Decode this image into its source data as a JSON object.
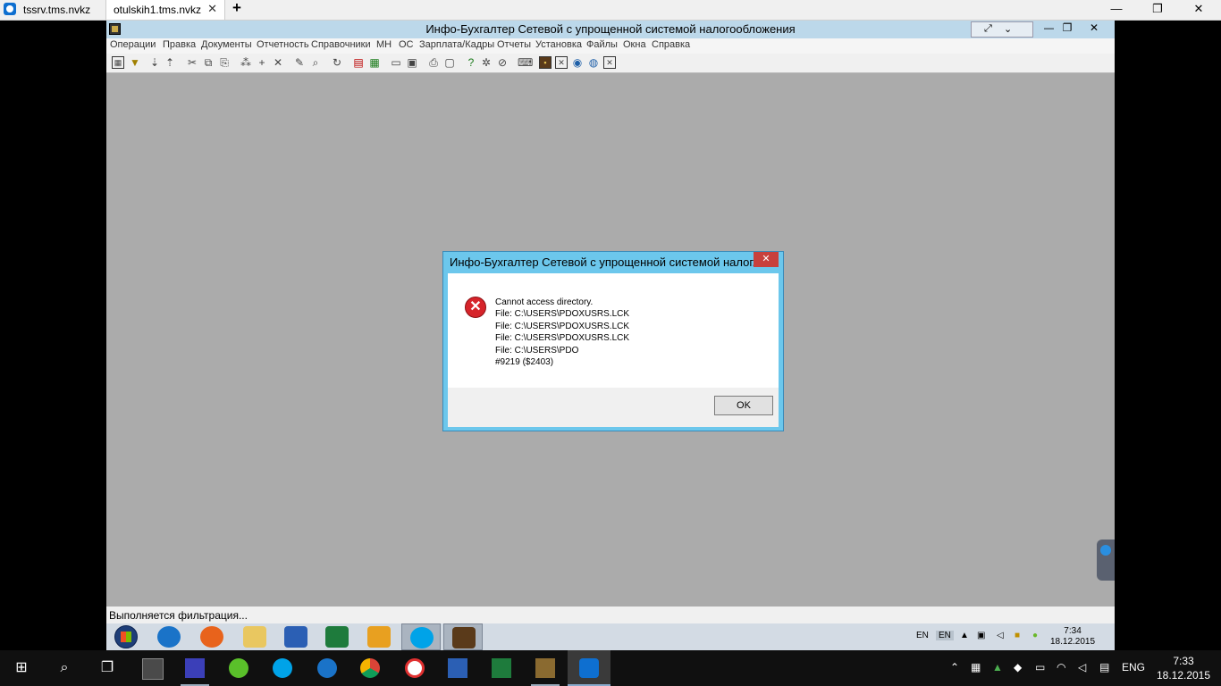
{
  "tabs": [
    {
      "label": "tssrv.tms.nvkz"
    },
    {
      "label": "otulskih1.tms.nvkz",
      "close": "✕"
    }
  ],
  "window_controls": {
    "minimize": "—",
    "restore": "❐",
    "close": "✕"
  },
  "app": {
    "title": "Инфо-Бухгалтер Сетевой с упрощенной системой налогообложения",
    "menu": [
      "Операции",
      "Правка",
      "Документы",
      "Отчетность",
      "Справочники",
      "МН",
      "ОС",
      "Зарплата/Кадры",
      "Отчеты",
      "Установка",
      "Файлы",
      "Окна",
      "Справка"
    ],
    "status_text": "Выполняется фильтрация..."
  },
  "dialog": {
    "title": "Инфо-Бухгалтер Сетевой с упрощенной системой налог...",
    "close_label": "✕",
    "lines": [
      "Cannot access directory.",
      "File: C:\\USERS\\PDOXUSRS.LCK",
      "File: C:\\USERS\\PDOXUSRS.LCK",
      "File: C:\\USERS\\PDOXUSRS.LCK",
      "File: C:\\USERS\\PDO",
      "#9219 ($2403)"
    ],
    "ok_label": "OK",
    "icon": "error-icon"
  },
  "remote_taskbar": {
    "lang1": "EN",
    "lang2": "EN",
    "time": "7:34",
    "date": "18.12.2015"
  },
  "local_taskbar": {
    "lang": "ENG",
    "time": "7:33",
    "date": "18.12.2015"
  },
  "colors": {
    "titlebar": "#bcd8ea",
    "dialog_frame": "#6cc7ec",
    "error_red": "#d6242a",
    "workspace": "#ababab"
  }
}
